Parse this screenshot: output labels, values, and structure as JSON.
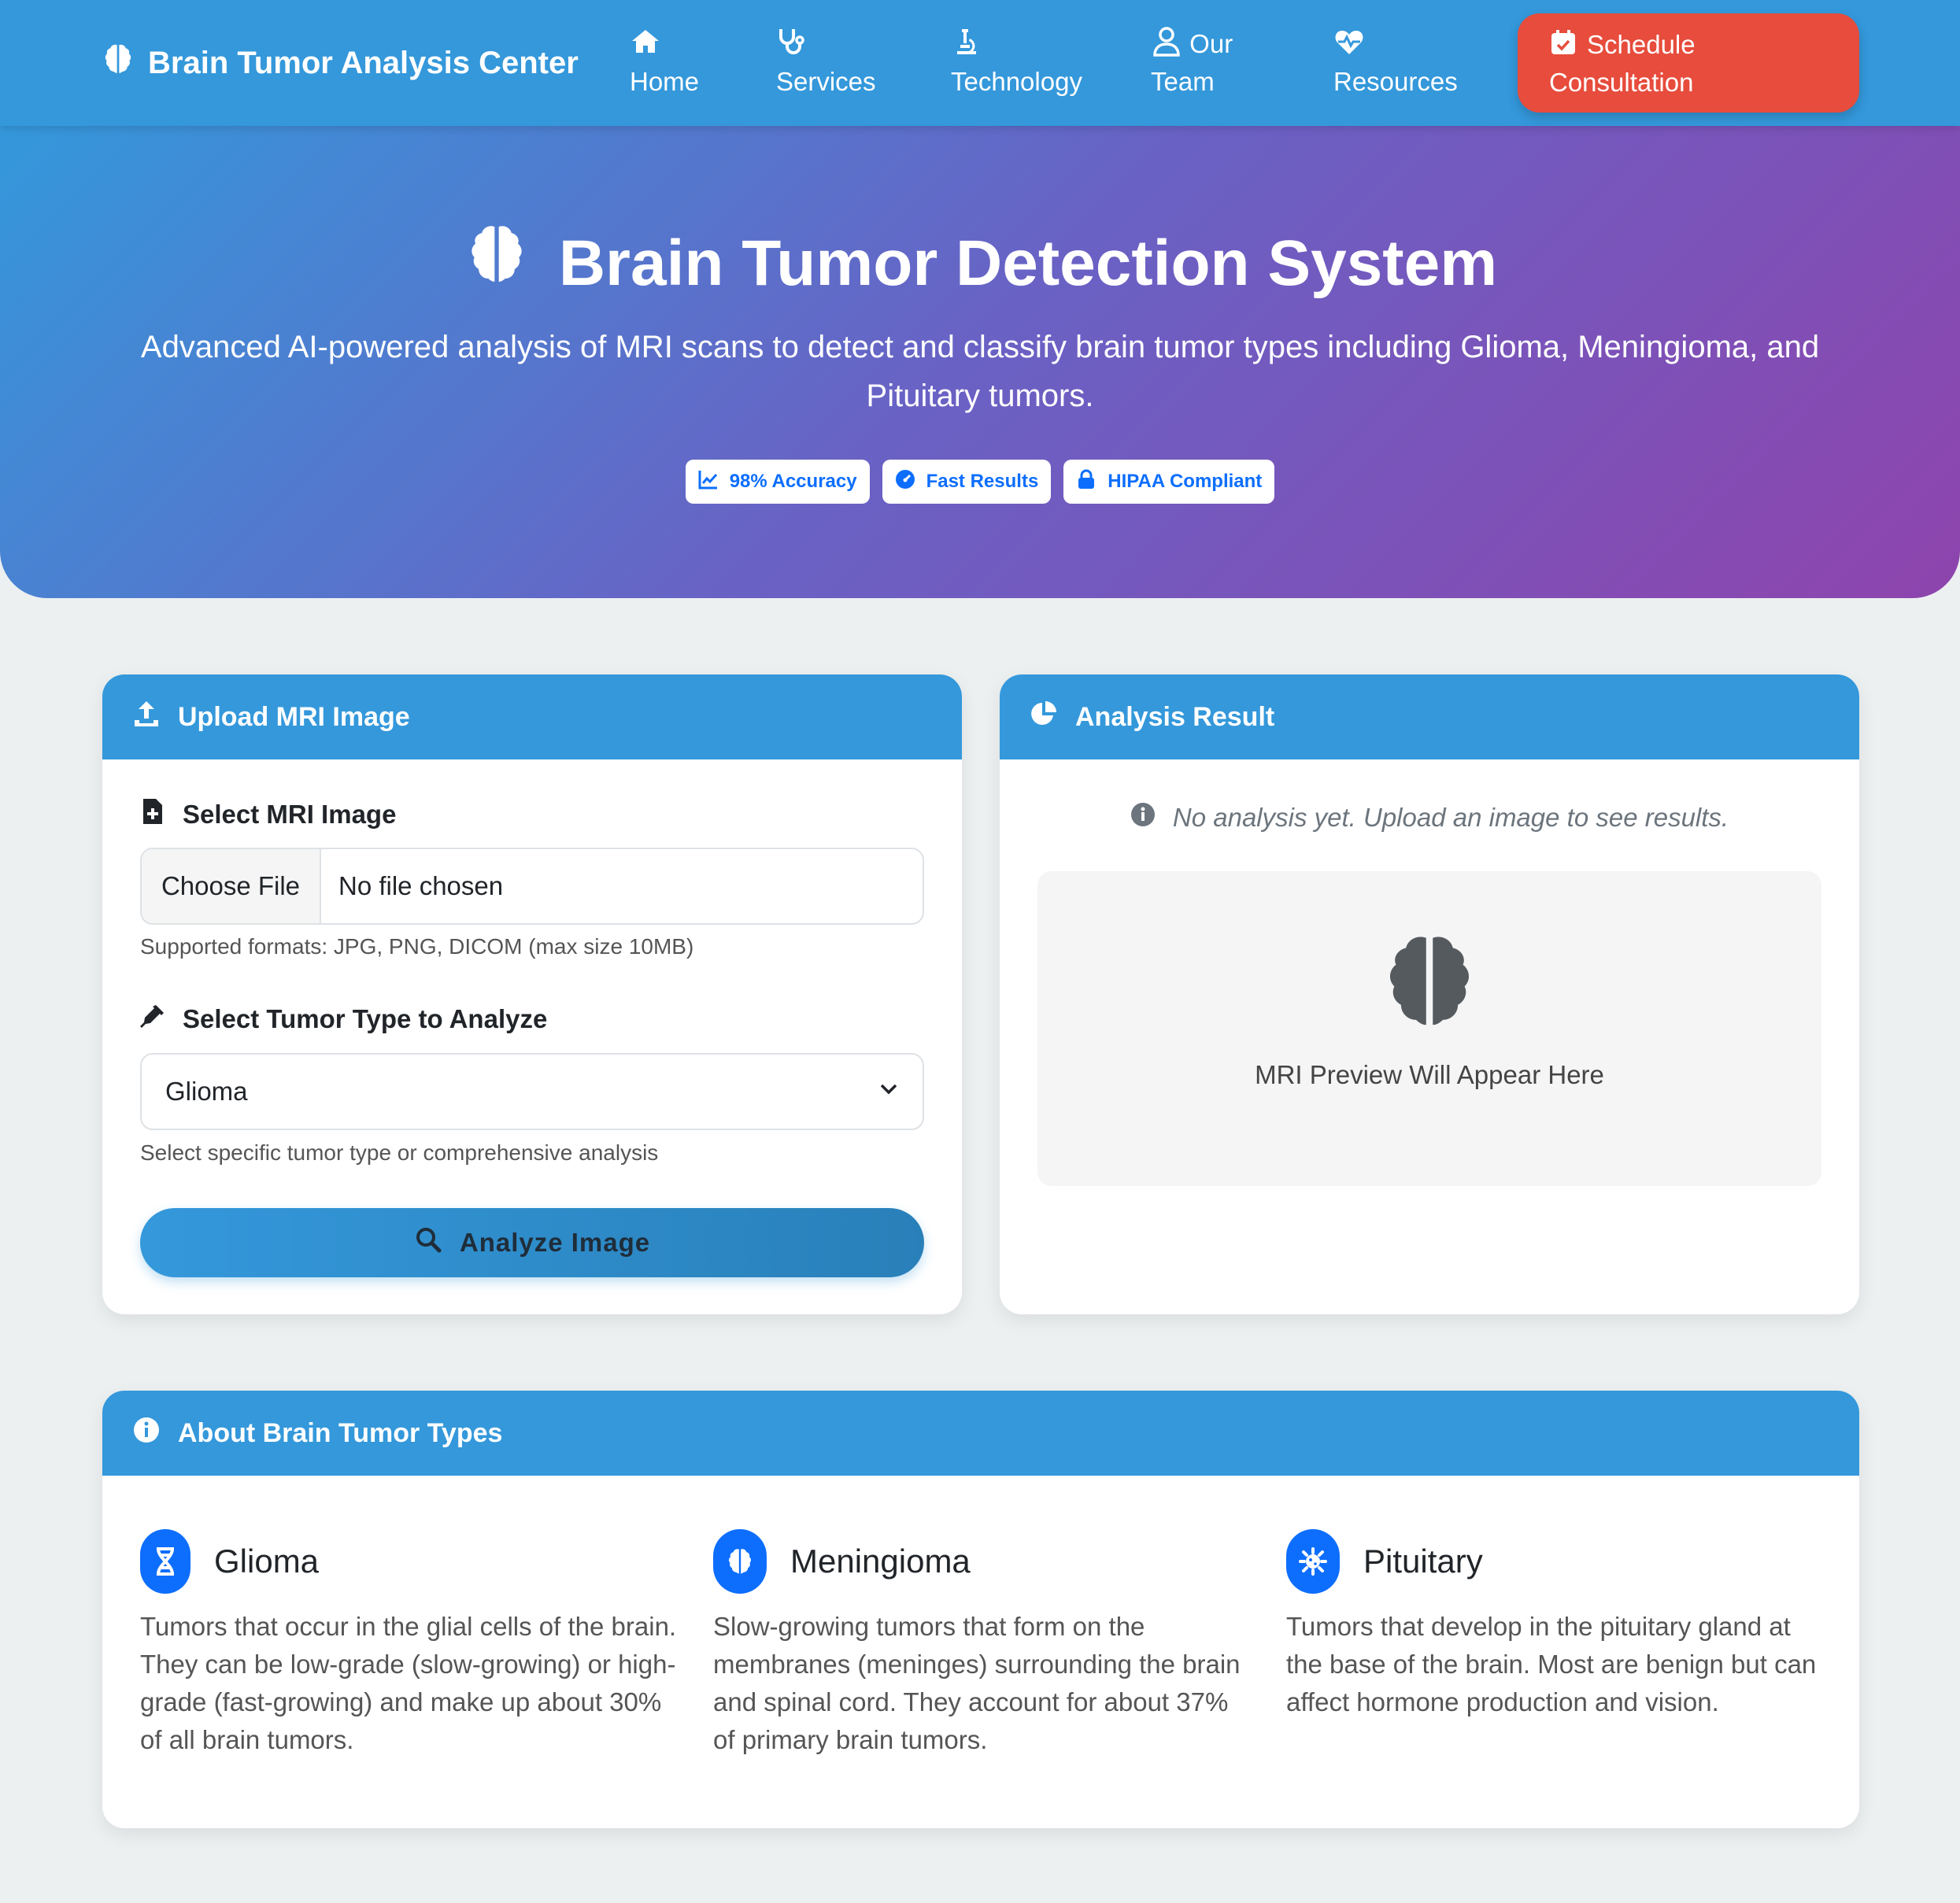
{
  "navbar": {
    "brand": "Brain Tumor Analysis Center",
    "items": [
      {
        "icon": "home-icon",
        "label": "Home"
      },
      {
        "icon": "stethoscope-icon",
        "label": "Services"
      },
      {
        "icon": "microscope-icon",
        "label": "Technology"
      },
      {
        "icon": "user-doctor-icon",
        "label_line1": "Our",
        "label_line2": "Team"
      },
      {
        "icon": "heart-pulse-icon",
        "label": "Resources"
      }
    ],
    "cta_line1": "Schedule",
    "cta_line2": "Consultation"
  },
  "hero": {
    "title": "Brain Tumor Detection System",
    "subtitle": "Advanced AI-powered analysis of MRI scans to detect and classify brain tumor types including Glioma, Meningioma, and Pituitary tumors.",
    "badges": [
      "98% Accuracy",
      "Fast Results",
      "HIPAA Compliant"
    ]
  },
  "upload": {
    "header": "Upload MRI Image",
    "select_label": "Select MRI Image",
    "choose_file": "Choose File",
    "no_file": "No file chosen",
    "formats_help": "Supported formats: JPG, PNG, DICOM (max size 10MB)",
    "type_label": "Select Tumor Type to Analyze",
    "selected_type": "Glioma",
    "type_help": "Select specific tumor type or comprehensive analysis",
    "analyze_button": "Analyze Image"
  },
  "result": {
    "header": "Analysis Result",
    "empty_message": "No analysis yet. Upload an image to see results.",
    "preview_text": "MRI Preview Will Appear Here"
  },
  "about": {
    "header": "About Brain Tumor Types",
    "types": [
      {
        "icon": "dna-icon",
        "title": "Glioma",
        "description": "Tumors that occur in the glial cells of the brain. They can be low-grade (slow-growing) or high-grade (fast-growing) and make up about 30% of all brain tumors."
      },
      {
        "icon": "brain-icon",
        "title": "Meningioma",
        "description": "Slow-growing tumors that form on the membranes (meninges) surrounding the brain and spinal cord. They account for about 37% of primary brain tumors."
      },
      {
        "icon": "virus-icon",
        "title": "Pituitary",
        "description": "Tumors that develop in the pituitary gland at the base of the brain. Most are benign but can affect hormone production and vision."
      }
    ]
  },
  "colors": {
    "primary": "#3498db",
    "accent": "#e74c3c",
    "gradient_end": "#8e44ad",
    "badge_text": "#0d6efd"
  }
}
